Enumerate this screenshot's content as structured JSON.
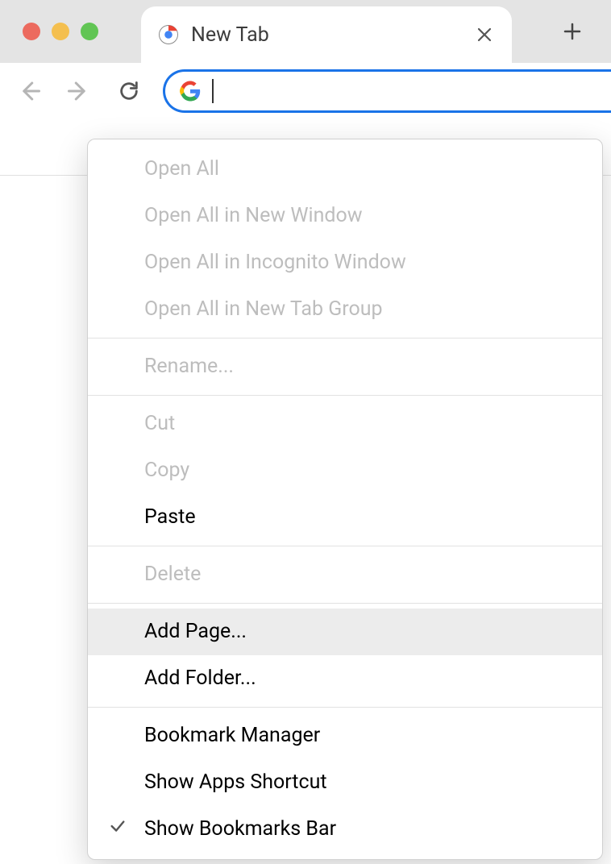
{
  "tab": {
    "title": "New Tab"
  },
  "context_menu": {
    "open_all": "Open All",
    "open_all_new_window": "Open All in New Window",
    "open_all_incognito": "Open All in Incognito Window",
    "open_all_tab_group": "Open All in New Tab Group",
    "rename": "Rename...",
    "cut": "Cut",
    "copy": "Copy",
    "paste": "Paste",
    "delete": "Delete",
    "add_page": "Add Page...",
    "add_folder": "Add Folder...",
    "bookmark_manager": "Bookmark Manager",
    "show_apps_shortcut": "Show Apps Shortcut",
    "show_bookmarks_bar": "Show Bookmarks Bar"
  }
}
